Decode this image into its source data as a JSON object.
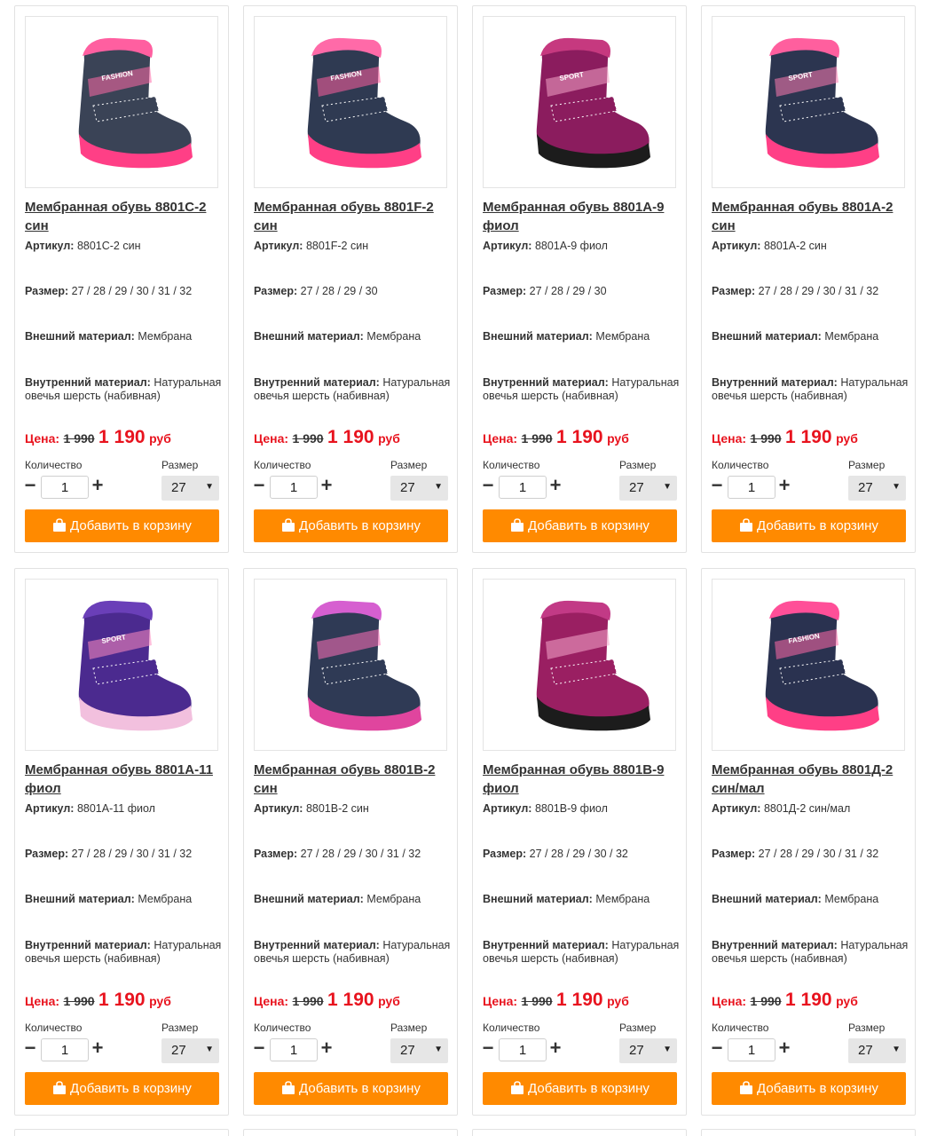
{
  "labels": {
    "article": "Артикул:",
    "size": "Размер:",
    "outer": "Внешний материал:",
    "inner": "Внутренний материал:",
    "price": "Цена:",
    "currency": "руб",
    "quantity": "Количество",
    "size_select": "Размер",
    "add_to_cart": "Добавить в корзину",
    "minus": "−",
    "plus": "+"
  },
  "products": [
    {
      "title_line1": "Мембранная обувь 8801C-2",
      "title_line2": "син",
      "article": "8801C-2 син",
      "sizes": "27 / 28 / 29 / 30 / 31 / 32",
      "outer_material": "Мембрана",
      "inner_material": "Натуральная овечья шерсть (набивная)",
      "old_price": "1 990",
      "price": "1 190",
      "quantity": "1",
      "selected_size": "27",
      "image": {
        "icon": "boot-image",
        "upper": "#3a4356",
        "cuff": "#ff5fa0",
        "sole": "#ff3f86",
        "accent": "#ff6aa8",
        "logo": "FASHION"
      }
    },
    {
      "title_line1": "Мембранная обувь 8801F-2",
      "title_line2": "син",
      "article": "8801F-2 син",
      "sizes": "27 / 28 / 29 / 30",
      "outer_material": "Мембрана",
      "inner_material": "Натуральная овечья шерсть (набивная)",
      "old_price": "1 990",
      "price": "1 190",
      "quantity": "1",
      "selected_size": "27",
      "image": {
        "icon": "boot-image",
        "upper": "#2f3a52",
        "cuff": "#ff6aa8",
        "sole": "#ff3f86",
        "accent": "#ff5f9e",
        "logo": "FASHION"
      }
    },
    {
      "title_line1": "Мембранная обувь 8801A-9",
      "title_line2": "фиол",
      "article": "8801A-9 фиол",
      "sizes": "27 / 28 / 29 / 30",
      "outer_material": "Мембрана",
      "inner_material": "Натуральная овечья шерсть (набивная)",
      "old_price": "1 990",
      "price": "1 190",
      "quantity": "1",
      "selected_size": "27",
      "image": {
        "icon": "boot-image",
        "upper": "#8b1c5e",
        "cuff": "#c6397f",
        "sole": "#1c1c1c",
        "accent": "#f4a6c8",
        "logo": "SPORT"
      }
    },
    {
      "title_line1": "Мембранная обувь 8801A-2",
      "title_line2": "син",
      "article": "8801A-2 син",
      "sizes": "27 / 28 / 29 / 30 / 31 / 32",
      "outer_material": "Мембрана",
      "inner_material": "Натуральная овечья шерсть (набивная)",
      "old_price": "1 990",
      "price": "1 190",
      "quantity": "1",
      "selected_size": "27",
      "image": {
        "icon": "boot-image",
        "upper": "#2c3550",
        "cuff": "#ff5f9e",
        "sole": "#ff3f86",
        "accent": "#ff7ab0",
        "logo": "SPORT"
      }
    },
    {
      "title_line1": "Мембранная обувь 8801A-11",
      "title_line2": "фиол",
      "article": "8801A-11 фиол",
      "sizes": "27 / 28 / 29 / 30 / 31 / 32",
      "outer_material": "Мембрана",
      "inner_material": "Натуральная овечья шерсть (набивная)",
      "old_price": "1 990",
      "price": "1 190",
      "quantity": "1",
      "selected_size": "27",
      "image": {
        "icon": "boot-image",
        "upper": "#4b2a8f",
        "cuff": "#6a3fb8",
        "sole": "#f2c0de",
        "accent": "#ff8ac0",
        "logo": "SPORT"
      }
    },
    {
      "title_line1": "Мембранная обувь 8801B-2",
      "title_line2": "син",
      "article": "8801B-2 син",
      "sizes": "27 / 28 / 29 / 30 / 31 / 32",
      "outer_material": "Мембрана",
      "inner_material": "Натуральная овечья шерсть (набивная)",
      "old_price": "1 990",
      "price": "1 190",
      "quantity": "1",
      "selected_size": "27",
      "image": {
        "icon": "boot-image",
        "upper": "#2f3a55",
        "cuff": "#d65fd0",
        "sole": "#e0459e",
        "accent": "#ff70b8",
        "logo": ""
      }
    },
    {
      "title_line1": "Мембранная обувь 8801B-9",
      "title_line2": "фиол",
      "article": "8801B-9 фиол",
      "sizes": "27 / 28 / 29 / 30 / 32",
      "outer_material": "Мембрана",
      "inner_material": "Натуральная овечья шерсть (набивная)",
      "old_price": "1 990",
      "price": "1 190",
      "quantity": "1",
      "selected_size": "27",
      "image": {
        "icon": "boot-image",
        "upper": "#9a1f62",
        "cuff": "#c23a86",
        "sole": "#1c1c1c",
        "accent": "#f6a8cc",
        "logo": ""
      }
    },
    {
      "title_line1": "Мембранная обувь 8801Д-2",
      "title_line2": "син/мал",
      "article": "8801Д-2 син/мал",
      "sizes": "27 / 28 / 29 / 30 / 31 / 32",
      "outer_material": "Мембрана",
      "inner_material": "Натуральная овечья шерсть (набивная)",
      "old_price": "1 990",
      "price": "1 190",
      "quantity": "1",
      "selected_size": "27",
      "image": {
        "icon": "boot-image",
        "upper": "#2a3250",
        "cuff": "#ff4f98",
        "sole": "#ff3f86",
        "accent": "#ff6aa8",
        "logo": "FASHION"
      }
    }
  ],
  "colors": {
    "price_red": "#e8131e",
    "button_orange": "#ff8a00",
    "select_gray": "#e6e6e6"
  }
}
